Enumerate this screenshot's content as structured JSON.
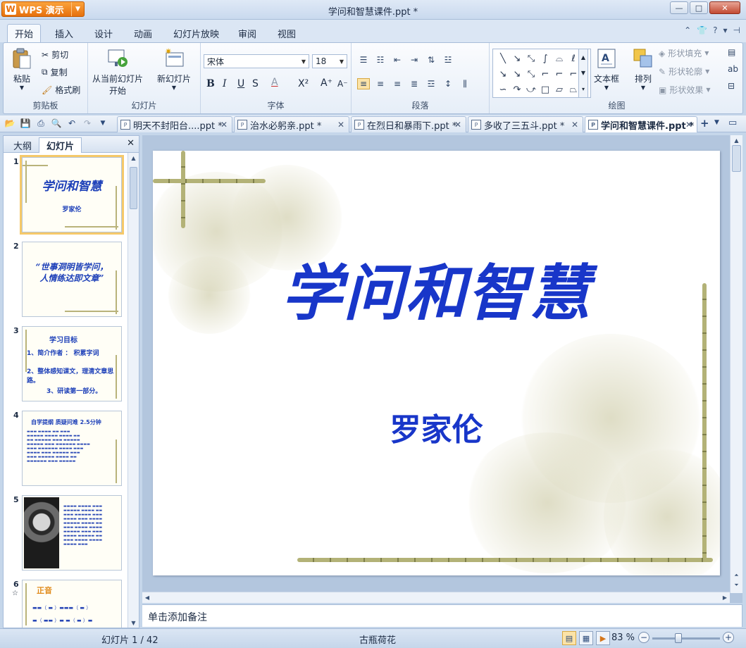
{
  "app": {
    "brand": "WPS 演示",
    "title": "学问和智慧课件.ppt *"
  },
  "ribbon_tabs": [
    "开始",
    "插入",
    "设计",
    "动画",
    "幻灯片放映",
    "审阅",
    "视图"
  ],
  "ribbon": {
    "clipboard": {
      "paste": "粘贴",
      "cut": "剪切",
      "copy": "复制",
      "format_painter": "格式刷",
      "label": "剪贴板"
    },
    "slides": {
      "from_current_line1": "从当前幻灯片",
      "from_current_line2": "开始",
      "new_slide": "新幻灯片",
      "label": "幻灯片"
    },
    "font": {
      "name": "宋体",
      "size": "18",
      "label": "字体"
    },
    "paragraph": {
      "label": "段落"
    },
    "drawing": {
      "textbox": "文本框",
      "arrange": "排列",
      "shape_fill": "形状填充",
      "shape_outline": "形状轮廓",
      "shape_effect": "形状效果",
      "label": "绘图"
    }
  },
  "doc_tabs": [
    {
      "label": "明天不封阳台....ppt *"
    },
    {
      "label": "治水必躬亲.ppt *"
    },
    {
      "label": "在烈日和暴雨下.ppt *"
    },
    {
      "label": "多收了三五斗.ppt *"
    },
    {
      "label": "学问和智慧课件.ppt *"
    }
  ],
  "left_panel": {
    "tabs": [
      "大纲",
      "幻灯片"
    ],
    "thumbnails": [
      {
        "num": "1",
        "title": "学问和智慧",
        "subtitle": "罗家伦"
      },
      {
        "num": "2",
        "line1": "“世事洞明皆学问，",
        "line2": "人情练达即文章”"
      },
      {
        "num": "3",
        "title": "学习目标",
        "items": [
          "1、简介作者 ： 积累字词",
          "2、整体感知课文，理清文章思路。",
          "3、研读第一部分。"
        ]
      },
      {
        "num": "4",
        "title": "自学提纲 质疑问难 2.5分钟"
      },
      {
        "num": "5"
      },
      {
        "num": "6",
        "title": "正音"
      }
    ]
  },
  "slide": {
    "title": "学问和智慧",
    "subtitle": "罗家伦"
  },
  "notes_placeholder": "单击添加备注",
  "status": {
    "slide_count": "幻灯片 1 / 42",
    "theme": "古瓶荷花",
    "zoom": "83 %"
  }
}
